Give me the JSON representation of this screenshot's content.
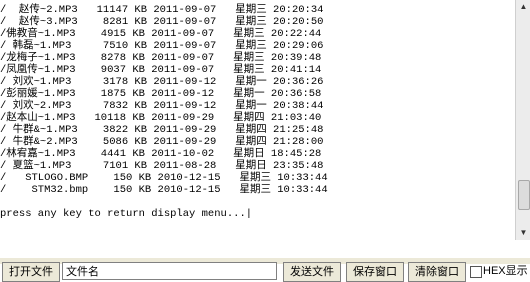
{
  "terminal": {
    "lines": [
      "/  赵传~2.MP3   11147 KB 2011-09-07   星期三 20:20:34",
      "/  赵传~3.MP3    8281 KB 2011-09-07   星期三 20:20:50",
      "/佛教音~1.MP3    4915 KB 2011-09-07   星期三 20:22:44",
      "/ 韩磊~1.MP3     7510 KB 2011-09-07   星期三 20:29:06",
      "/龙梅子~1.MP3    8278 KB 2011-09-07   星期三 20:39:48",
      "/凤凰传~1.MP3    9037 KB 2011-09-07   星期三 20:41:14",
      "/ 刘欢~1.MP3     3178 KB 2011-09-12   星期一 20:36:26",
      "/彭丽媛~1.MP3    1875 KB 2011-09-12   星期一 20:36:58",
      "/ 刘欢~2.MP3     7832 KB 2011-09-12   星期一 20:38:44",
      "/赵本山~1.MP3   10118 KB 2011-09-29   星期四 21:03:40",
      "/ 牛群&~1.MP3    3822 KB 2011-09-29   星期四 21:25:48",
      "/ 牛群&~2.MP3    5086 KB 2011-09-29   星期四 21:28:00",
      "/林宥嘉~1.MP3    4441 KB 2011-10-02   星期日 18:45:28",
      "/ 夏篮~1.MP3     7101 KB 2011-08-28   星期日 23:35:48",
      "/   STLOGO.BMP    150 KB 2010-12-15   星期三 10:33:44",
      "/    STM32.bmp    150 KB 2010-12-15   星期三 10:33:44",
      "",
      "press any key to return display menu...|"
    ]
  },
  "toolbar": {
    "open_file_label": "打开文件",
    "filename_value": "文件名",
    "send_file_label": "发送文件",
    "save_window_label": "保存窗口",
    "clear_window_label": "清除窗口",
    "hex_label": "HEX显示"
  }
}
